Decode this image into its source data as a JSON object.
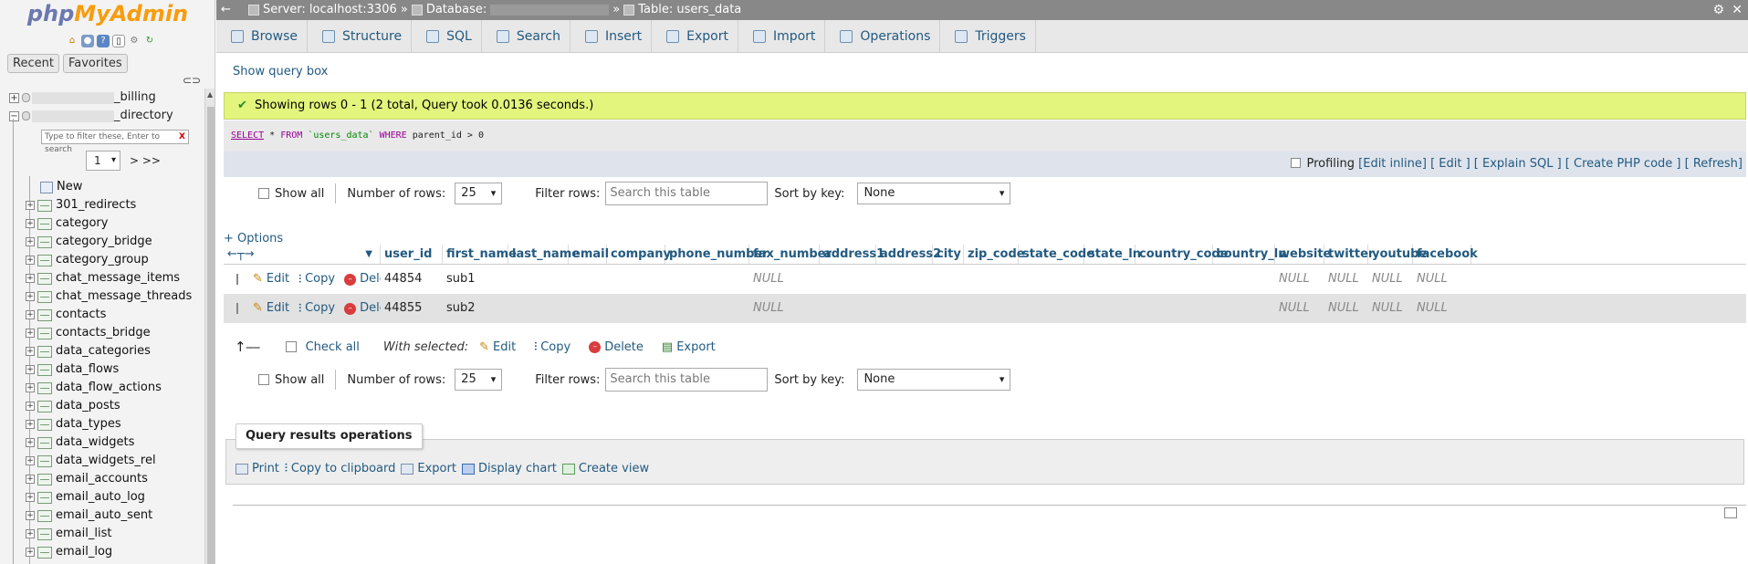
{
  "nav": {
    "logo_php": "php",
    "logo_myadmin": "MyAdmin",
    "tabs": [
      "Recent",
      "Favorites"
    ],
    "databases": [
      {
        "suffix": "_billing"
      },
      {
        "suffix": "_directory"
      }
    ],
    "filter_placeholder": "Type to filter these, Enter to search",
    "filter_clear": "X",
    "page_select": "1",
    "page_more": "> >>",
    "new_label": "New",
    "tables": [
      "301_redirects",
      "category",
      "category_bridge",
      "category_group",
      "chat_message_items",
      "chat_message_threads",
      "contacts",
      "contacts_bridge",
      "data_categories",
      "data_flows",
      "data_flow_actions",
      "data_posts",
      "data_types",
      "data_widgets",
      "data_widgets_rel",
      "email_accounts",
      "email_auto_log",
      "email_auto_sent",
      "email_list",
      "email_log"
    ]
  },
  "topbar": {
    "back": "←",
    "server": "Server: localhost:3306 »",
    "database": "Database:",
    "database_sep": "»",
    "table": "Table: users_data"
  },
  "tabs": [
    "Browse",
    "Structure",
    "SQL",
    "Search",
    "Insert",
    "Export",
    "Import",
    "Operations",
    "Triggers"
  ],
  "main": {
    "show_query_box": "Show query box",
    "success_message": "Showing rows 0 - 1 (2 total, Query took 0.0136 seconds.)",
    "sql": {
      "select": "SELECT",
      "star": " * ",
      "from": "FROM",
      "table": " `users_data` ",
      "where": "WHERE",
      "condition": " parent_id > 0"
    },
    "profiling": {
      "label": "Profiling",
      "edit_inline": "[Edit inline]",
      "edit": "[ Edit ]",
      "explain": "[ Explain SQL ]",
      "create_php": "[ Create PHP code ]",
      "refresh": "[ Refresh]"
    },
    "controls": {
      "show_all": "Show all",
      "number_of_rows_label": "Number of rows:",
      "number_of_rows_value": "25",
      "filter_rows_label": "Filter rows:",
      "filter_rows_placeholder": "Search this table",
      "sort_by_key_label": "Sort by key:",
      "sort_by_key_value": "None"
    },
    "options_link": "+ Options",
    "columns": [
      "user_id",
      "first_name",
      "last_name",
      "email",
      "company",
      "phone_number",
      "fax_number",
      "address1",
      "address2",
      "city",
      "zip_code",
      "state_code",
      "state_ln",
      "country_code",
      "country_ln",
      "website",
      "twitter",
      "youtube",
      "facebook"
    ],
    "row_actions": {
      "edit": "Edit",
      "copy": "Copy",
      "delete": "Delete"
    },
    "rows": [
      {
        "user_id": "44854",
        "first_name": "sub1",
        "fax_number": "NULL",
        "website": "NULL",
        "twitter": "NULL",
        "youtube": "NULL",
        "facebook": "NULL"
      },
      {
        "user_id": "44855",
        "first_name": "sub2",
        "fax_number": "NULL",
        "website": "NULL",
        "twitter": "NULL",
        "youtube": "NULL",
        "facebook": "NULL"
      }
    ],
    "bulk": {
      "check_all": "Check all",
      "with_selected": "With selected:",
      "edit": "Edit",
      "copy": "Copy",
      "delete": "Delete",
      "export": "Export"
    },
    "query_results_operations": {
      "title": "Query results operations",
      "print": "Print",
      "copy_to_clipboard": "Copy to clipboard",
      "export": "Export",
      "display_chart": "Display chart",
      "create_view": "Create view"
    }
  }
}
